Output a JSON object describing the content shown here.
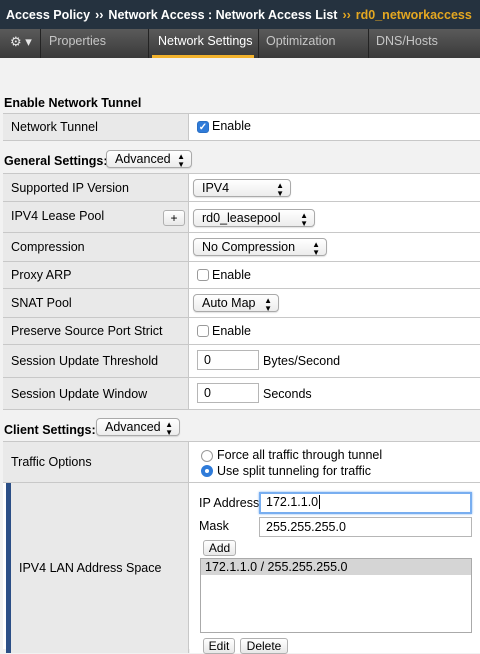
{
  "breadcrumb": {
    "part1": "Access Policy",
    "sep1": "››",
    "part2": "Network Access : Network Access List",
    "sep2": "››",
    "current": "rd0_networkaccess"
  },
  "tabs": {
    "gear_icon": "⚙ ▾",
    "items": [
      {
        "label": "Properties"
      },
      {
        "label": "Network Settings"
      },
      {
        "label": "Optimization"
      },
      {
        "label": "DNS/Hosts"
      }
    ],
    "active": "Network Settings",
    "accent": "#f2b22c"
  },
  "enable_tunnel": {
    "heading": "Enable Network Tunnel",
    "label": "Network Tunnel",
    "checkbox_label": "Enable",
    "checked": true
  },
  "general": {
    "heading": "General Settings:",
    "mode": "Advanced",
    "rows": {
      "ip_version": {
        "label": "Supported IP Version",
        "value": "IPV4"
      },
      "lease_pool": {
        "label": "IPV4 Lease Pool",
        "plus": "+",
        "value": "rd0_leasepool"
      },
      "compression": {
        "label": "Compression",
        "value": "No Compression"
      },
      "proxy_arp": {
        "label": "Proxy ARP",
        "checkbox_label": "Enable",
        "checked": false
      },
      "snat_pool": {
        "label": "SNAT Pool",
        "value": "Auto Map"
      },
      "preserve_port": {
        "label": "Preserve Source Port Strict",
        "checkbox_label": "Enable",
        "checked": false
      },
      "update_threshold": {
        "label": "Session Update Threshold",
        "value": "0",
        "unit": "Bytes/Second"
      },
      "update_window": {
        "label": "Session Update Window",
        "value": "0",
        "unit": "Seconds"
      }
    }
  },
  "client": {
    "heading": "Client Settings:",
    "mode": "Advanced",
    "traffic": {
      "label": "Traffic Options",
      "option1": "Force all traffic through tunnel",
      "option2": "Use split tunneling for traffic",
      "selected": "option2"
    },
    "lan": {
      "label": "IPV4 LAN Address Space",
      "ip_label": "IP Address",
      "ip_value": "172.1.1.0",
      "mask_label": "Mask",
      "mask_value": "255.255.255.0",
      "add_label": "Add",
      "list": [
        "172.1.1.0 / 255.255.255.0"
      ],
      "edit_label": "Edit",
      "delete_label": "Delete"
    }
  },
  "colors": {
    "titlebar": "#25323f",
    "selected_item": "#d5d5d5",
    "left_accent": "#2c4f86"
  }
}
